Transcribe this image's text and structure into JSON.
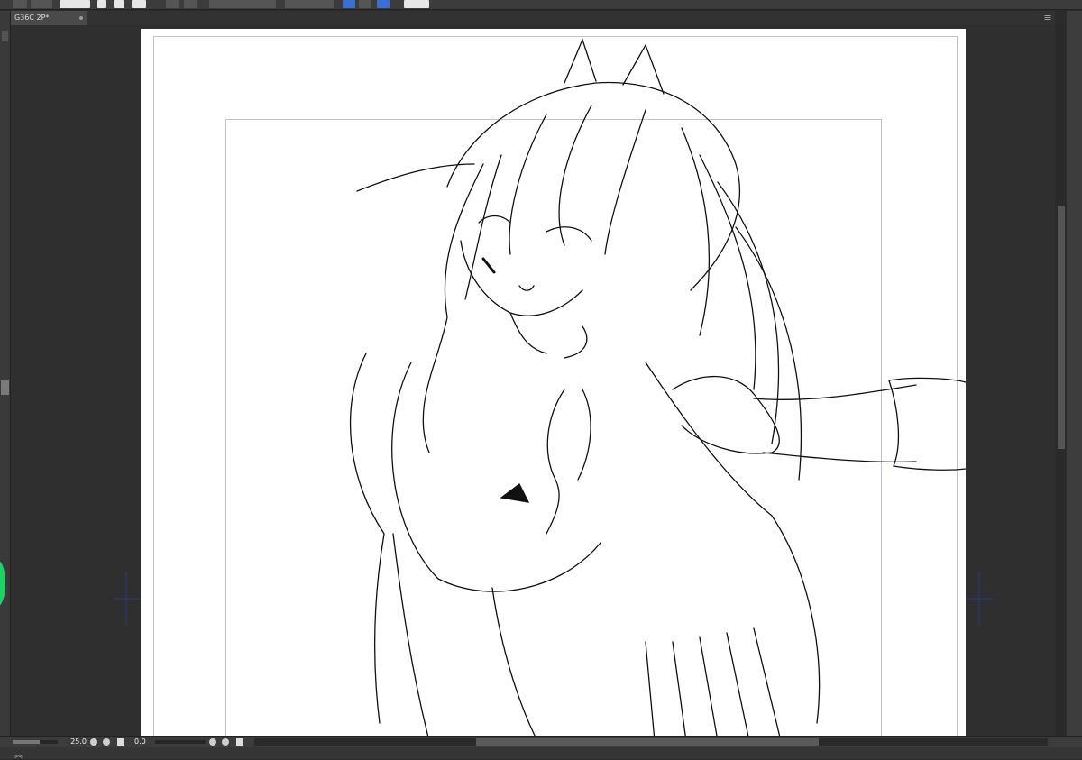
{
  "document": {
    "tab_title": "G36C 2P*"
  },
  "toolbar": {
    "icons": [
      "menu-grid-icon",
      "layer-icon",
      "rotate-icon",
      "new-file-icon",
      "open-file-icon",
      "save-icon",
      "undo-icon",
      "redo-icon",
      "transform-icon",
      "select-icon",
      "pen-icon",
      "ruler-icon",
      "brush-icon",
      "settings-icon"
    ]
  },
  "status": {
    "zoom": "25.0",
    "angle": "0.0"
  },
  "colors": {
    "ui_dark": "#2b2b2b",
    "panel": "#3c3c3c",
    "paper": "#ffffff",
    "frame_guide": "#bfc4d6",
    "accent": "#3a6fd8",
    "indicator_green": "#1bd466"
  }
}
